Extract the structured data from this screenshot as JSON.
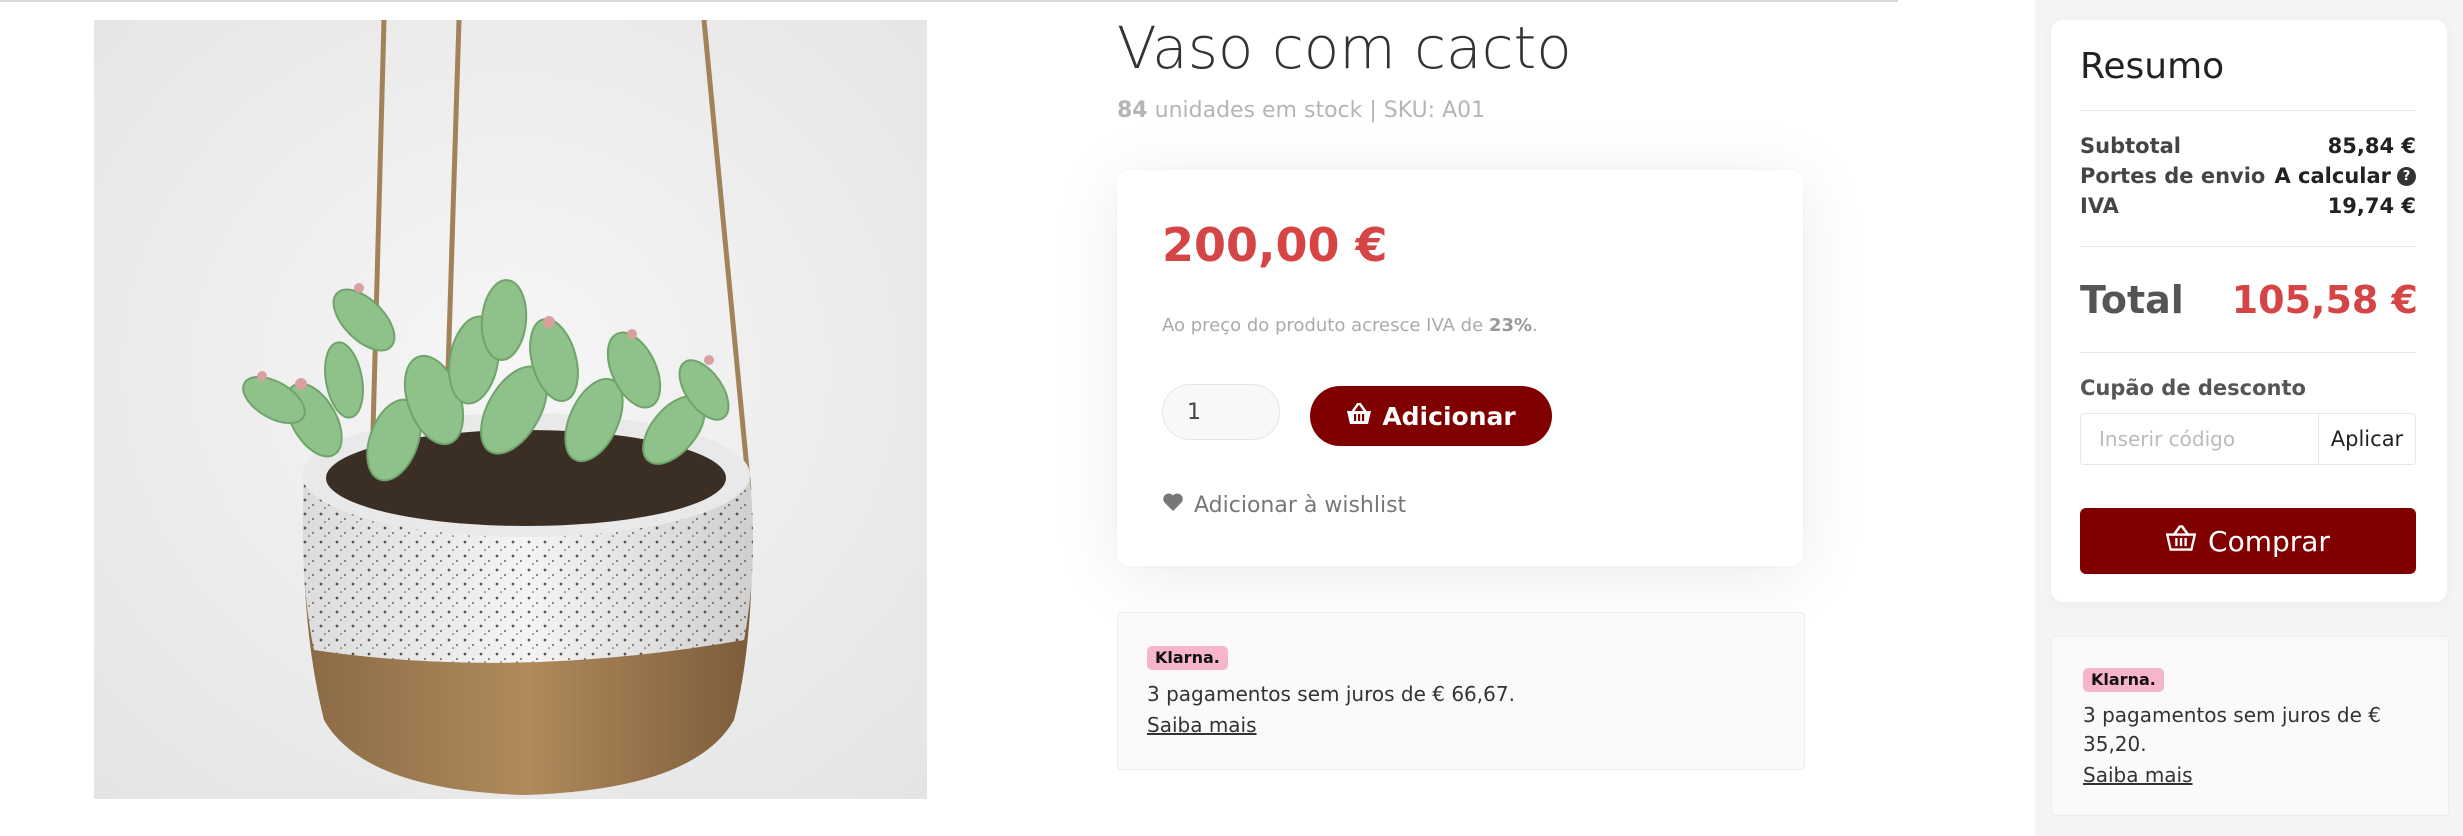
{
  "product": {
    "title": "Vaso com cacto",
    "stock_count": "84",
    "stock_text": "unidades em stock | SKU: A01",
    "image_alt": "Vaso suspenso com suculentas"
  },
  "buy_card": {
    "price": "200,00 €",
    "vat_note_prefix": "Ao preço do produto acresce IVA de",
    "vat_rate": "23%",
    "vat_note_suffix": ".",
    "quantity": "1",
    "add_button_label": "Adicionar",
    "wishlist_label": "Adicionar à wishlist"
  },
  "klarna_main": {
    "logo": "Klarna.",
    "text": "3 pagamentos sem juros de € 66,67.",
    "link": "Saiba mais"
  },
  "summary": {
    "title": "Resumo",
    "subtotal_label": "Subtotal",
    "subtotal_value": "85,84 €",
    "shipping_label": "Portes de envio",
    "shipping_value": "A calcular",
    "vat_label": "IVA",
    "vat_value": "19,74 €",
    "total_label": "Total",
    "total_value": "105,58 €",
    "coupon_label": "Cupão de desconto",
    "coupon_placeholder": "Inserir código",
    "apply_label": "Aplicar",
    "buy_label": "Comprar"
  },
  "klarna_side": {
    "logo": "Klarna.",
    "text": "3 pagamentos sem juros de € 35,20.",
    "link": "Saiba mais"
  },
  "colors": {
    "accent": "#800000",
    "price_red": "#d64545",
    "klarna_pink": "#f7b5cb"
  },
  "icons": {
    "basket": "basket-icon",
    "heart": "heart-icon",
    "help": "question-circle-icon"
  }
}
